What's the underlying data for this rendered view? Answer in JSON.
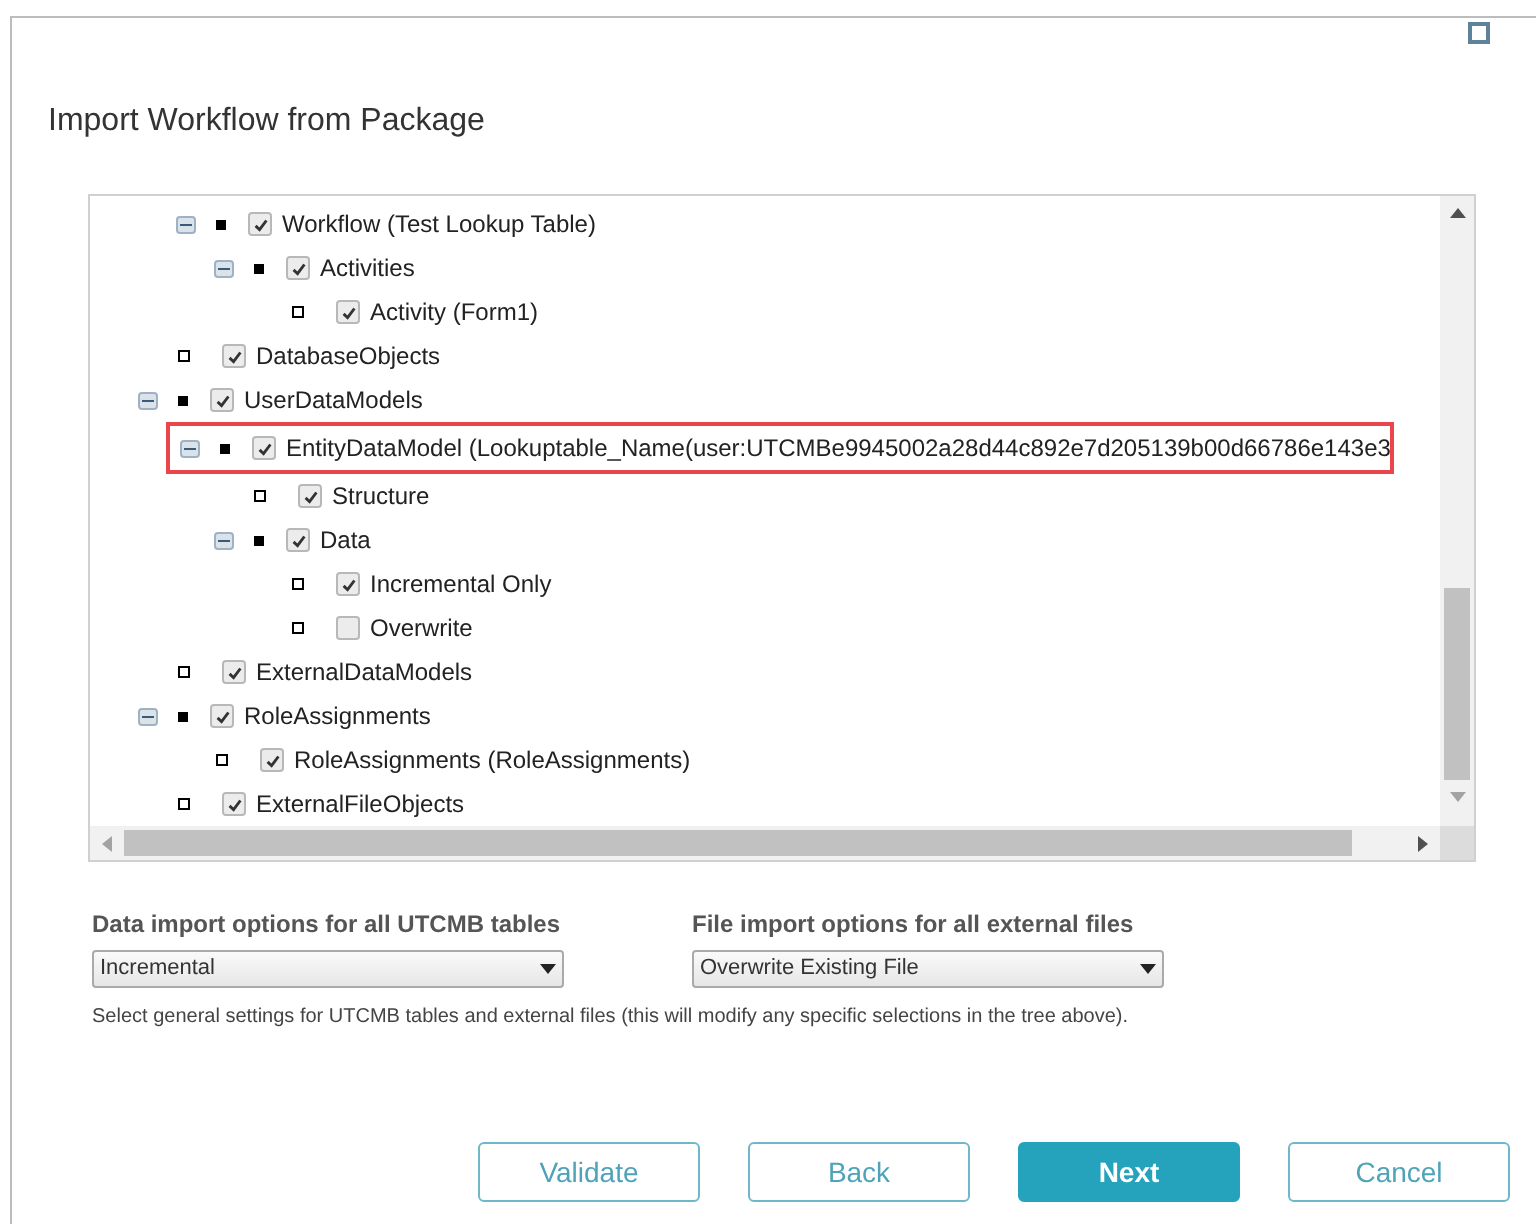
{
  "dialog": {
    "title": "Import Workflow from Package"
  },
  "tree": {
    "items": [
      {
        "kind": "hidden",
        "children": [
          {
            "label": "Workflow (Test Lookup Table)",
            "checked": true,
            "expanded": true,
            "highlighted": false,
            "children": [
              {
                "label": "Activities",
                "checked": true,
                "expanded": true,
                "highlighted": false,
                "children": [
                  {
                    "label": "Activity (Form1)",
                    "checked": true,
                    "highlighted": false
                  }
                ]
              }
            ]
          }
        ]
      },
      {
        "label": "DatabaseObjects",
        "checked": true,
        "highlighted": false
      },
      {
        "label": "UserDataModels",
        "checked": true,
        "expanded": true,
        "highlighted": false,
        "children": [
          {
            "label": "EntityDataModel (Lookuptable_Name(user:UTCMBe9945002a28d44c892e7d205139b00d66786e143e3",
            "checked": true,
            "expanded": true,
            "highlighted": true,
            "children": [
              {
                "label": "Structure",
                "checked": true,
                "highlighted": false
              },
              {
                "label": "Data",
                "checked": true,
                "expanded": true,
                "highlighted": false,
                "children": [
                  {
                    "label": "Incremental Only",
                    "checked": true,
                    "highlighted": false
                  },
                  {
                    "label": "Overwrite",
                    "checked": false,
                    "highlighted": false
                  }
                ]
              }
            ]
          }
        ]
      },
      {
        "label": "ExternalDataModels",
        "checked": true,
        "highlighted": false
      },
      {
        "label": "RoleAssignments",
        "checked": true,
        "expanded": true,
        "highlighted": false,
        "children": [
          {
            "label": "RoleAssignments (RoleAssignments)",
            "checked": true,
            "highlighted": false
          }
        ]
      },
      {
        "label": "ExternalFileObjects",
        "checked": true,
        "highlighted": false
      }
    ]
  },
  "options": [
    {
      "label": "Data import options for all UTCMB tables",
      "value": "Incremental"
    },
    {
      "label": "File import options for all external files",
      "value": "Overwrite Existing File"
    }
  ],
  "note": "Select general settings for UTCMB tables and external files (this will modify any specific selections in the tree above).",
  "buttons": [
    {
      "label": "Validate",
      "primary": false
    },
    {
      "label": "Back",
      "primary": false
    },
    {
      "label": "Next",
      "primary": true
    },
    {
      "label": "Cancel",
      "primary": false
    }
  ]
}
